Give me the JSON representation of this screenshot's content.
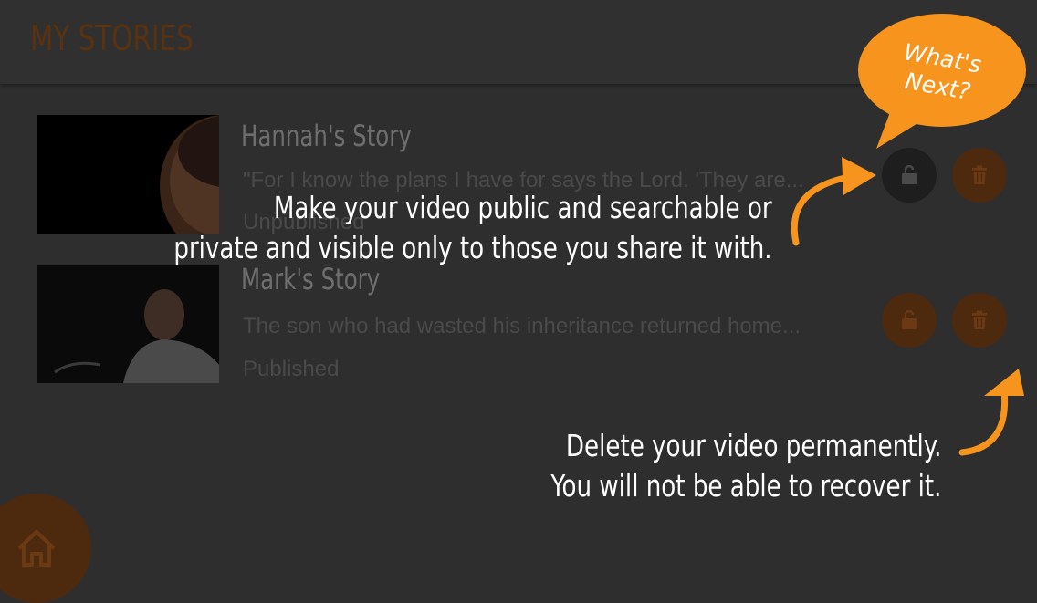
{
  "app": {
    "title": "MY STORIES"
  },
  "stories": [
    {
      "title": "Hannah's Story",
      "description": "\"For I know the plans I have for  says the Lord. 'They are...",
      "status": "Unpublished",
      "lock_icon": "lock-open-icon",
      "delete_icon": "trash-icon"
    },
    {
      "title": "Mark's Story",
      "description": "The son who had wasted his inheritance returned home...",
      "status": "Published",
      "lock_icon": "lock-open-icon",
      "delete_icon": "trash-icon"
    }
  ],
  "tutorial": {
    "bubble_line1": "What's",
    "bubble_line2": "Next?",
    "lock_hint_line1": "Make your video public and searchable or",
    "lock_hint_line2": "private and visible only to those you share it with.",
    "delete_hint_line1": "Delete your video permanently.",
    "delete_hint_line2": "You will not be able to recover it."
  },
  "nav": {
    "home_icon": "home-icon"
  },
  "colors": {
    "accent": "#f7941d",
    "dim_accent": "#4d2a0e",
    "background": "#2e2e2e"
  }
}
